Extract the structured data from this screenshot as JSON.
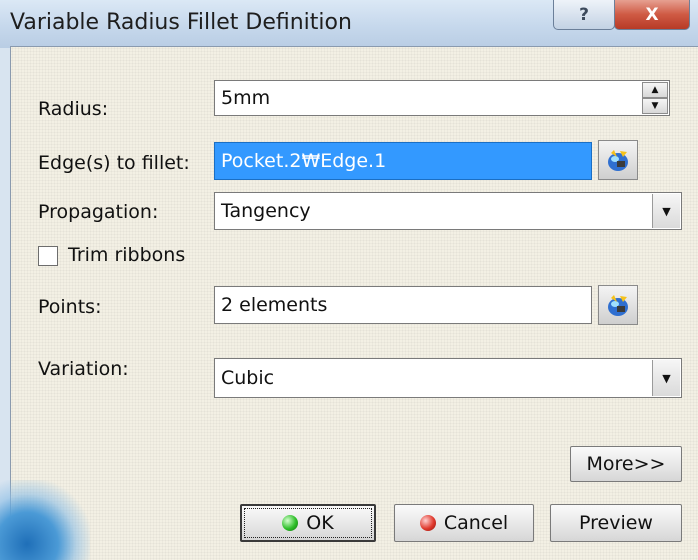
{
  "window": {
    "title": "Variable Radius Fillet Definition",
    "help_glyph": "?",
    "close_glyph": "X"
  },
  "form": {
    "radius_label": "Radius:",
    "radius_value": "5mm",
    "edges_label": "Edge(s) to fillet:",
    "edges_value": "Pocket.2₩Edge.1",
    "propagation_label": "Propagation:",
    "propagation_value": "Tangency",
    "trim_label": "Trim ribbons",
    "trim_checked": false,
    "points_label": "Points:",
    "points_value": "2 elements",
    "variation_label": "Variation:",
    "variation_value": "Cubic"
  },
  "buttons": {
    "more": "More>>",
    "ok": "OK",
    "cancel": "Cancel",
    "preview": "Preview"
  },
  "icons": {
    "spin_up": "▲",
    "spin_down": "▼",
    "dropdown": "▼",
    "selector": "selection-mode-icon"
  },
  "colors": {
    "selection_highlight": "#3399ff",
    "client_bg": "#f3f0e4",
    "close_red": "#c7482f"
  }
}
